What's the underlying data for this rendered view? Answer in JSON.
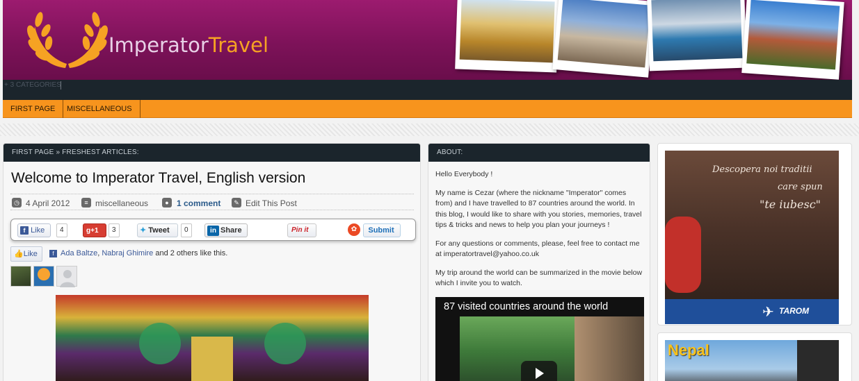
{
  "header": {
    "logo_text_main": "Imperator",
    "logo_text_accent": "Travel"
  },
  "catbar": {
    "label": "+ 3 CATEGORIES"
  },
  "menu": {
    "items": [
      "FIRST PAGE",
      "MISCELLANEOUS"
    ]
  },
  "main": {
    "breadcrumb": "FIRST PAGE » FRESHEST ARTICLES:",
    "post": {
      "title": "Welcome to Imperator Travel, English version",
      "date": "4 April 2012",
      "category": "miscellaneous",
      "comments": "1 comment",
      "edit": "Edit This Post"
    },
    "share": {
      "fb_like": "Like",
      "fb_count": "4",
      "gplus": "+1",
      "gplus_count": "3",
      "tweet": "Tweet",
      "tweet_count": "0",
      "linkedin": "Share",
      "pinit": "Pin it",
      "stumble": "Submit"
    },
    "likes": {
      "button": "Like",
      "name1": "Ada Baltze",
      "sep": ", ",
      "name2": "Nabraj Ghimire",
      "rest": " and 2 others like this."
    }
  },
  "about": {
    "heading": "ABOUT:",
    "p1": "Hello Everybody !",
    "p2": "My name is Cezar (where the nickname \"Imperator\" comes from) and I have travelled to 87 countries around the world. In this blog, I would like to share with you stories, memories, travel tips & tricks and news to help you plan your journeys !",
    "p3": "For any questions or comments, please, feel free to contact me at imperatortravel@yahoo.co.uk",
    "p4": "My trip around the world can be summarized in the movie below which I invite you to watch.",
    "video_title": "87 visited countries around the world"
  },
  "ads": {
    "tarom_line1": "Descopera noi traditii",
    "tarom_line2": "care spun",
    "tarom_line3": "\"te iubesc\"",
    "tarom_brand": "TAROM",
    "nepal": "Nepal"
  },
  "colors": {
    "header_bg": "#7d1259",
    "menu_bg": "#f7941d",
    "dark_bar": "#1b252c",
    "accent": "#f6a223"
  }
}
